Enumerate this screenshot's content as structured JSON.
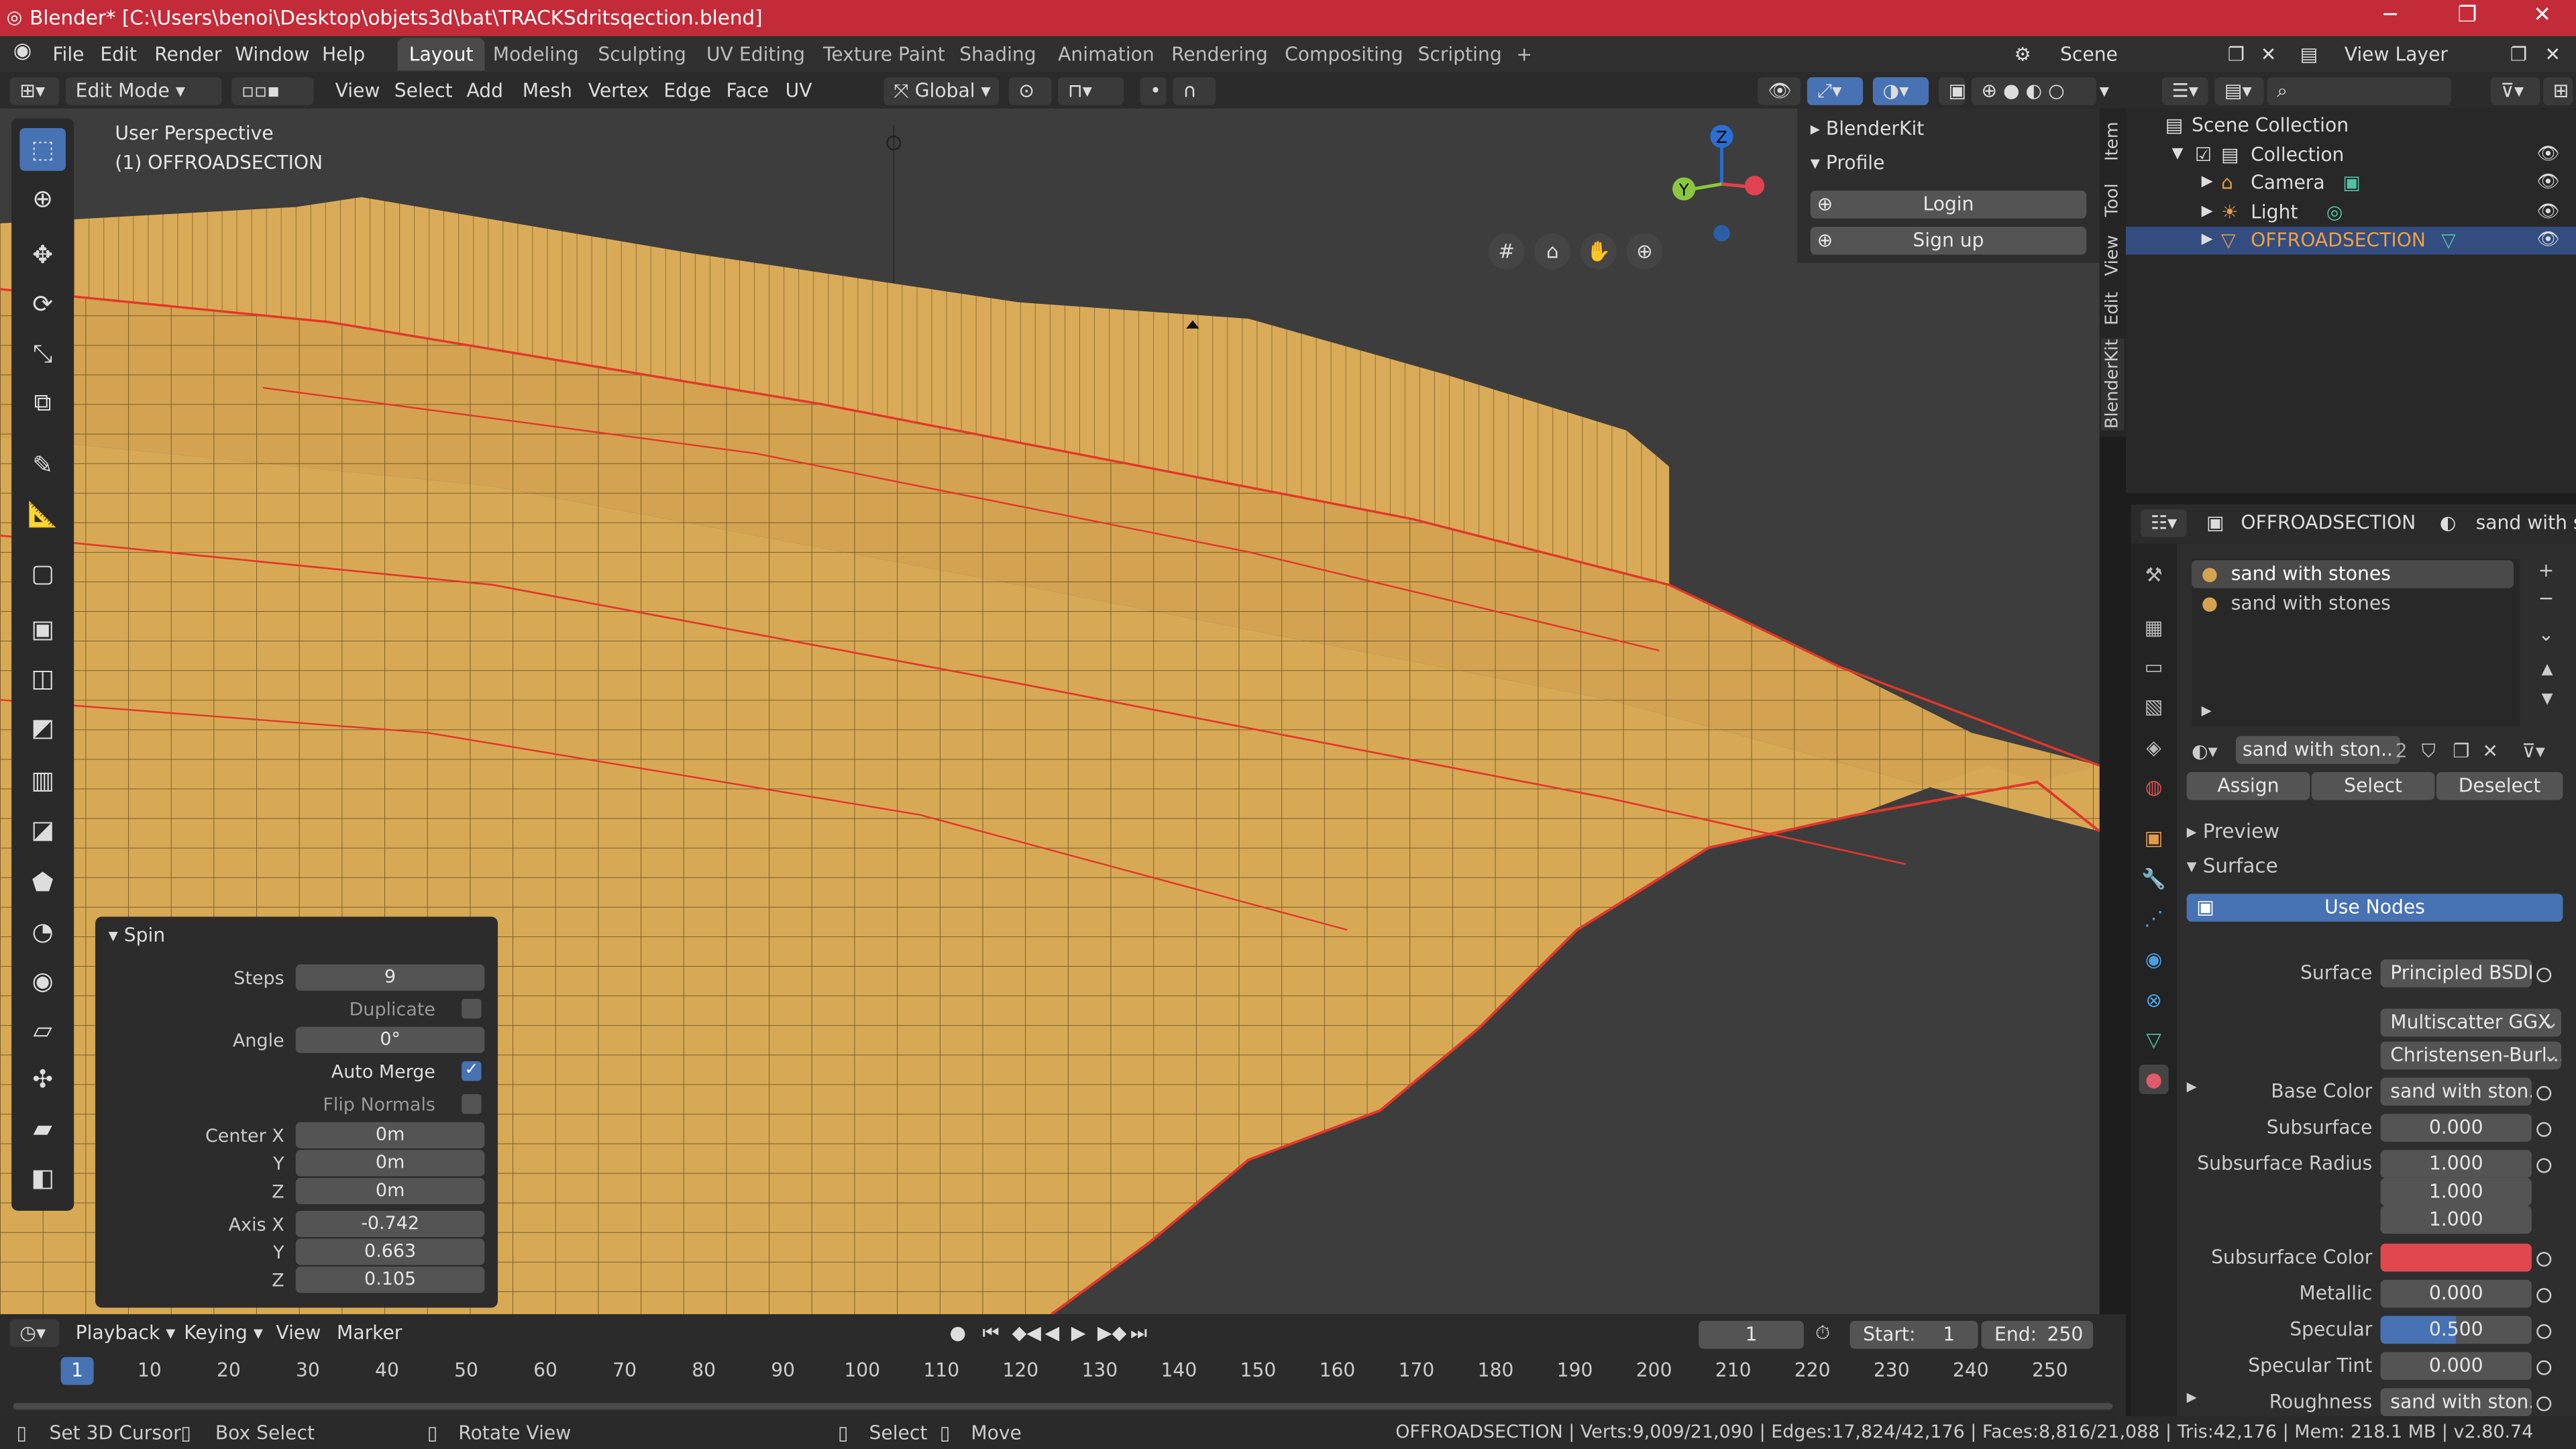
{
  "titlebar": {
    "title": "Blender* [C:\\Users\\benoi\\Desktop\\objets3d\\bat\\TRACKSdritsqection.blend]",
    "minimize": "─",
    "maximize": "❐",
    "close": "✕"
  },
  "menu": {
    "items": [
      "File",
      "Edit",
      "Render",
      "Window",
      "Help"
    ]
  },
  "workspaces": [
    "Layout",
    "Modeling",
    "Sculpting",
    "UV Editing",
    "Texture Paint",
    "Shading",
    "Animation",
    "Rendering",
    "Compositing",
    "Scripting",
    "+"
  ],
  "scene": {
    "label": "Scene"
  },
  "view_layer": {
    "label": "View Layer"
  },
  "viewport_header": {
    "mode": "Edit Mode",
    "menus": [
      "View",
      "Select",
      "Add",
      "Mesh",
      "Vertex",
      "Edge",
      "Face",
      "UV"
    ],
    "orientation": "Global"
  },
  "viewport": {
    "perspective": "User Perspective",
    "object": "(1) OFFROADSECTION",
    "gizmo_axes": [
      "Z",
      "Y"
    ],
    "accent": "#e3372a",
    "mesh_color": "#d6a652"
  },
  "npanel": {
    "blenderkit": "BlenderKit",
    "profile": "Profile",
    "login": "Login",
    "signup": "Sign up",
    "tabs": [
      "Item",
      "Tool",
      "View",
      "Edit",
      "BlenderKit"
    ]
  },
  "spin_panel": {
    "title": "Spin",
    "steps_label": "Steps",
    "steps": "9",
    "duplicate_label": "Duplicate",
    "angle_label": "Angle",
    "angle": "0°",
    "auto_merge_label": "Auto Merge",
    "flip_normals_label": "Flip Normals",
    "center_x_label": "Center X",
    "center_x": "0m",
    "y_label": "Y",
    "z_label": "Z",
    "center_y": "0m",
    "center_z": "0m",
    "axis_x_label": "Axis X",
    "axis_x": "-0.742",
    "axis_y": "0.663",
    "axis_z": "0.105",
    "duplicate": false,
    "auto_merge": true,
    "flip_normals": false
  },
  "timeline": {
    "menus": [
      "Playback",
      "Keying",
      "View",
      "Marker"
    ],
    "current_frame": "1",
    "start_label": "Start:",
    "start": "1",
    "end_label": "End:",
    "end": "250",
    "ticks": [
      "10",
      "20",
      "30",
      "40",
      "50",
      "60",
      "70",
      "80",
      "90",
      "100",
      "110",
      "120",
      "130",
      "140",
      "150",
      "160",
      "170",
      "180",
      "190",
      "200",
      "210",
      "220",
      "230",
      "240",
      "250"
    ],
    "frame_badge": "1"
  },
  "status": {
    "set_cursor": "Set 3D Cursor",
    "box_select": "Box Select",
    "rotate_view": "Rotate View",
    "select": "Select",
    "move": "Move",
    "stats": "OFFROADSECTION | Verts:9,009/21,090 | Edges:17,824/42,176 | Faces:8,816/21,088 | Tris:42,176 | Mem: 218.1 MB | v2.80.74"
  },
  "outliner": {
    "scene_collection": "Scene Collection",
    "collection": "Collection",
    "items": [
      "Camera",
      "Light",
      "OFFROADSECTION"
    ]
  },
  "properties": {
    "object": "OFFROADSECTION",
    "material_header": "sand with st",
    "slots": [
      "sand with stones",
      "sand with stones"
    ],
    "material_name": "sand with ston..",
    "users": "2",
    "assign": "Assign",
    "select": "Select",
    "deselect": "Deselect",
    "preview": "Preview",
    "surface": "Surface",
    "use_nodes": "Use Nodes",
    "rows": [
      {
        "label": "Surface",
        "value": "Principled BSDF"
      },
      {
        "label": "",
        "value": "Multiscatter GGX"
      },
      {
        "label": "",
        "value": "Christensen-Burl..."
      },
      {
        "label": "Base Color",
        "value": "sand with ston.."
      },
      {
        "label": "Subsurface",
        "value": "0.000"
      },
      {
        "label": "Subsurface Radius",
        "value": "1.000"
      },
      {
        "label": "",
        "value": "1.000"
      },
      {
        "label": "",
        "value": "1.000"
      },
      {
        "label": "Subsurface Color",
        "value": ""
      },
      {
        "label": "Metallic",
        "value": "0.000"
      },
      {
        "label": "Specular",
        "value": "0.500"
      },
      {
        "label": "Specular Tint",
        "value": "0.000"
      },
      {
        "label": "Roughness",
        "value": "sand with ston.."
      }
    ],
    "subsurface_color": "#e0474f",
    "specular_fill": 0.5
  }
}
